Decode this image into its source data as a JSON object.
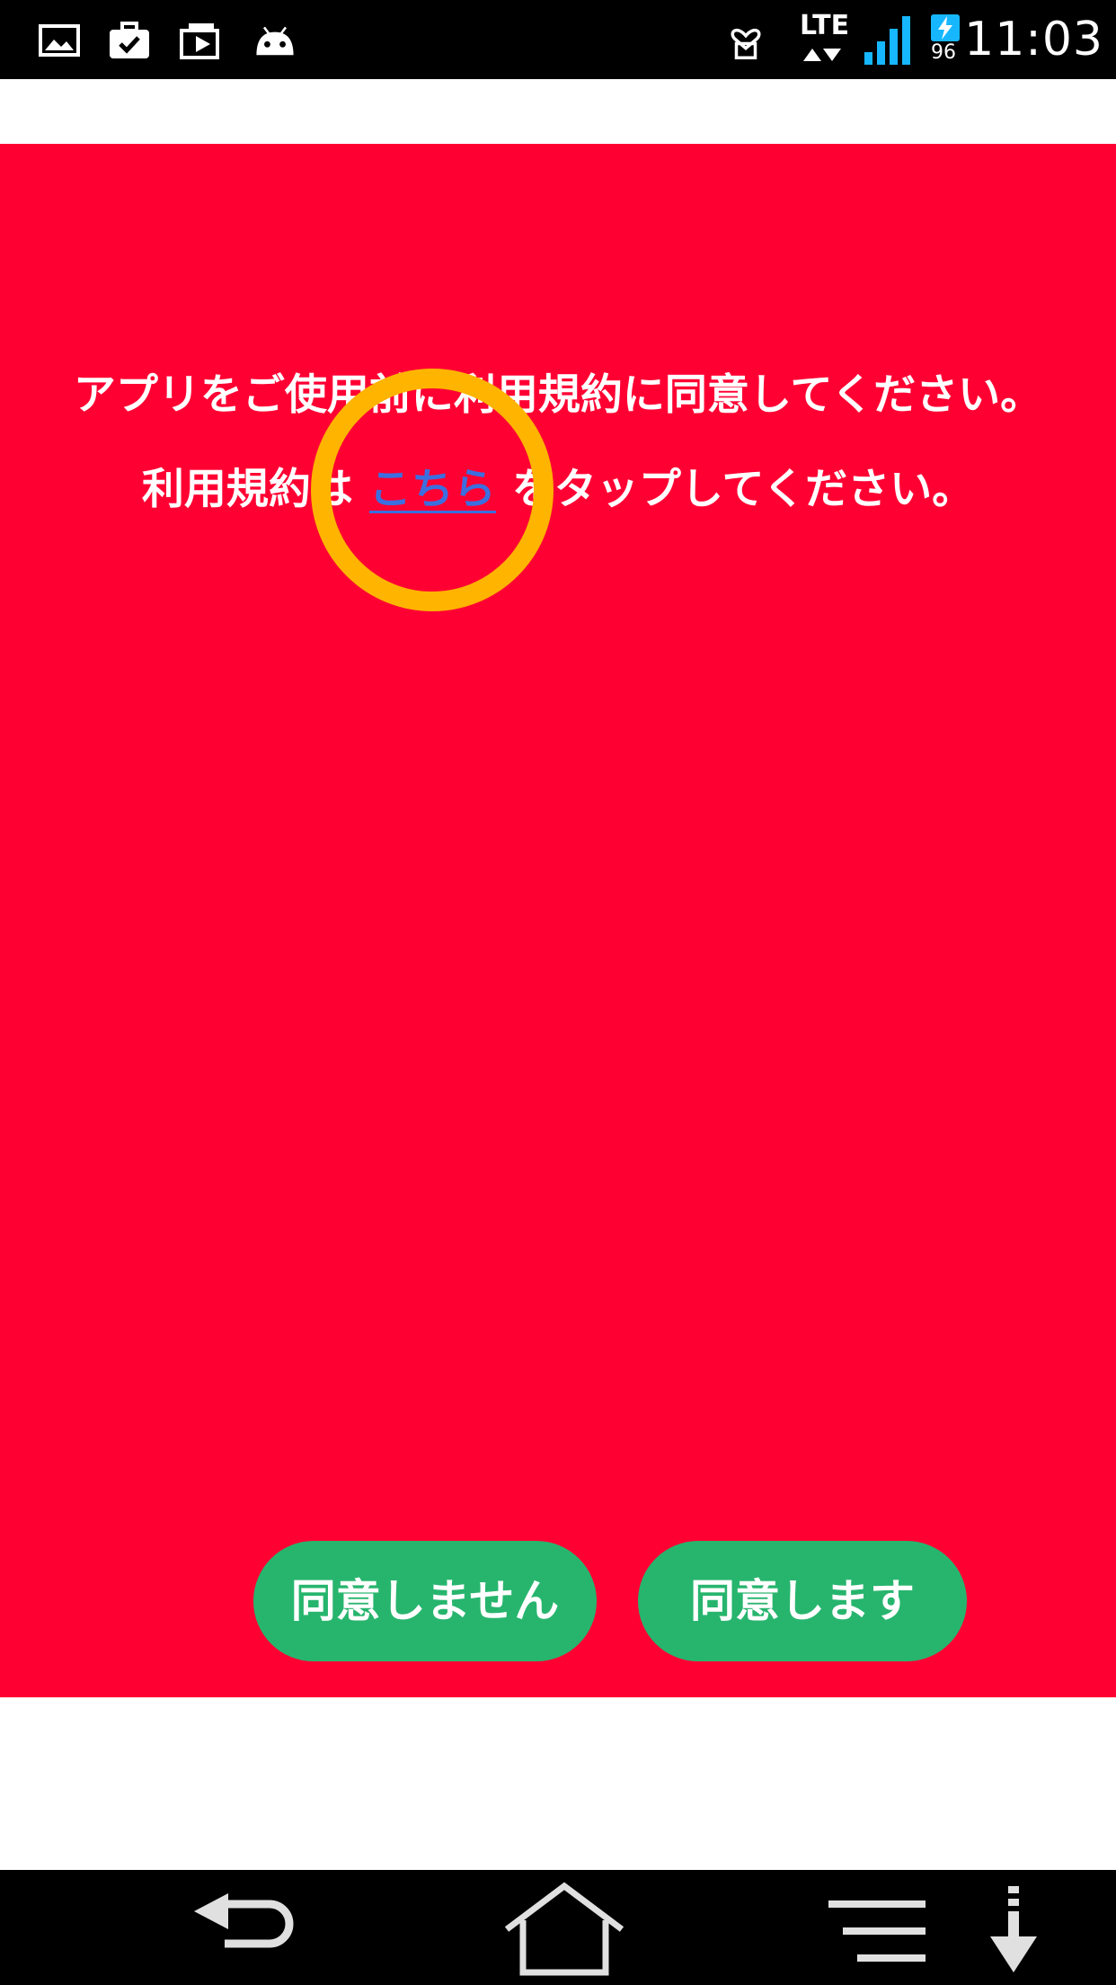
{
  "status_bar": {
    "time": "11:03",
    "network": "LTE",
    "battery_percent": "96",
    "left_icons": [
      "gallery-icon",
      "briefcase-check-icon",
      "media-bag-icon",
      "android-icon"
    ],
    "right_icons": [
      "heart-device-icon",
      "lte-data-icon",
      "signal-icon",
      "battery-charging-icon"
    ]
  },
  "main": {
    "background_color": "#ff0033",
    "message_line1": "アプリをご使用前に利用規約に同意してください。",
    "message_line2_prefix": "利用規約は",
    "terms_link_label": "こちら",
    "message_line2_suffix": "をタップしてください。",
    "highlight_color": "#ffb400",
    "link_color": "#3b6fe0"
  },
  "buttons": {
    "disagree_label": "同意しません",
    "agree_label": "同意します",
    "button_color": "#27b56e"
  },
  "nav_bar": {
    "icons": [
      "back-icon",
      "home-icon",
      "menu-icon",
      "download-icon"
    ]
  }
}
